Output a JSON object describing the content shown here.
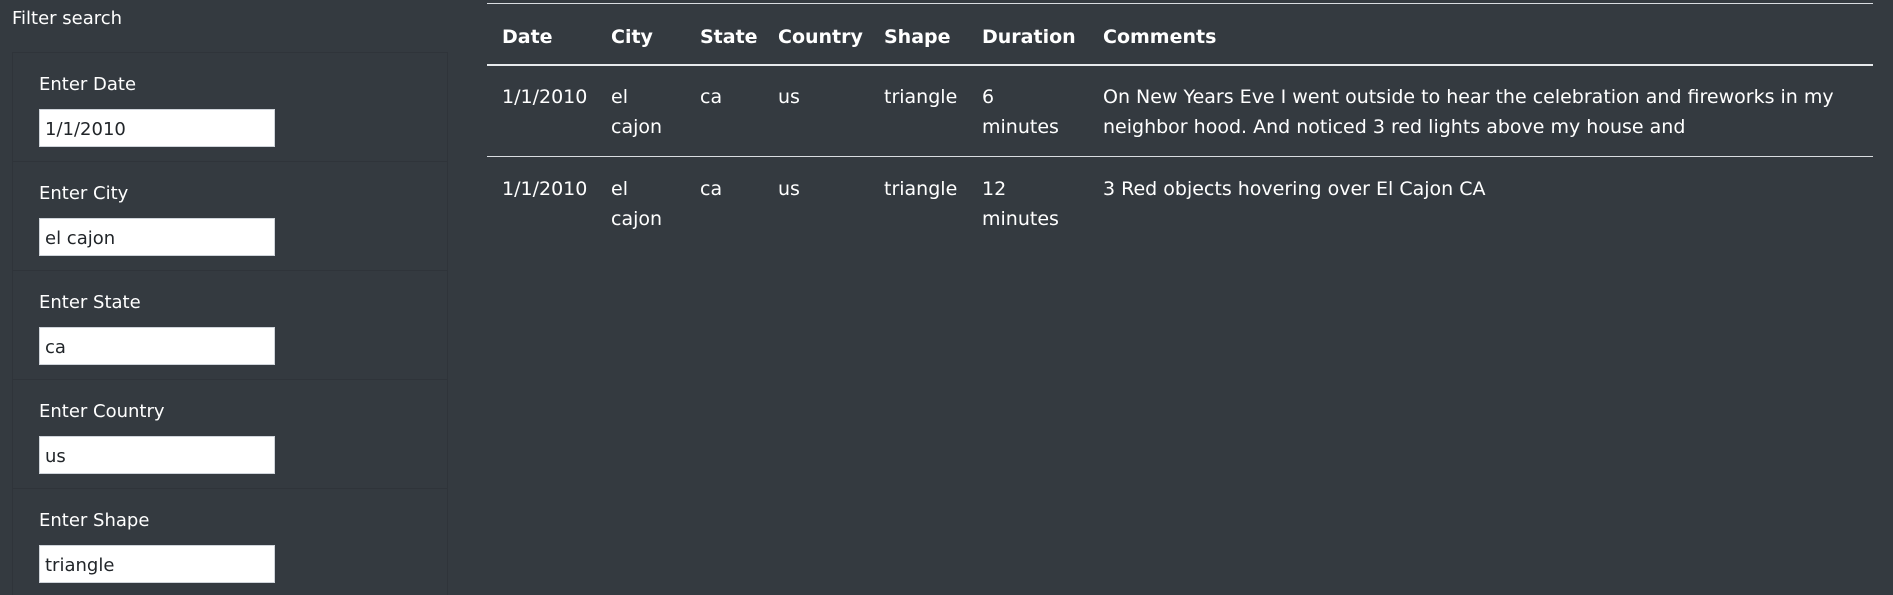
{
  "filter": {
    "title": "Filter search",
    "fields": [
      {
        "label": "Enter Date",
        "value": "1/1/2010"
      },
      {
        "label": "Enter City",
        "value": "el cajon"
      },
      {
        "label": "Enter State",
        "value": "ca"
      },
      {
        "label": "Enter Country",
        "value": "us"
      },
      {
        "label": "Enter Shape",
        "value": "triangle"
      }
    ]
  },
  "table": {
    "headers": [
      "Date",
      "City",
      "State",
      "Country",
      "Shape",
      "Duration",
      "Comments"
    ],
    "rows": [
      [
        "1/1/2010",
        "el cajon",
        "ca",
        "us",
        "triangle",
        "6 minutes",
        "On New Years Eve I went outside to hear the celebration and fireworks in my neighbor hood. And noticed 3 red lights above my house and"
      ],
      [
        "1/1/2010",
        "el cajon",
        "ca",
        "us",
        "triangle",
        "12 minutes",
        "3 Red objects hovering over El Cajon CA"
      ]
    ]
  },
  "colors": {
    "background": "#343a40",
    "text": "#ffffff",
    "input_background": "#ffffff"
  }
}
